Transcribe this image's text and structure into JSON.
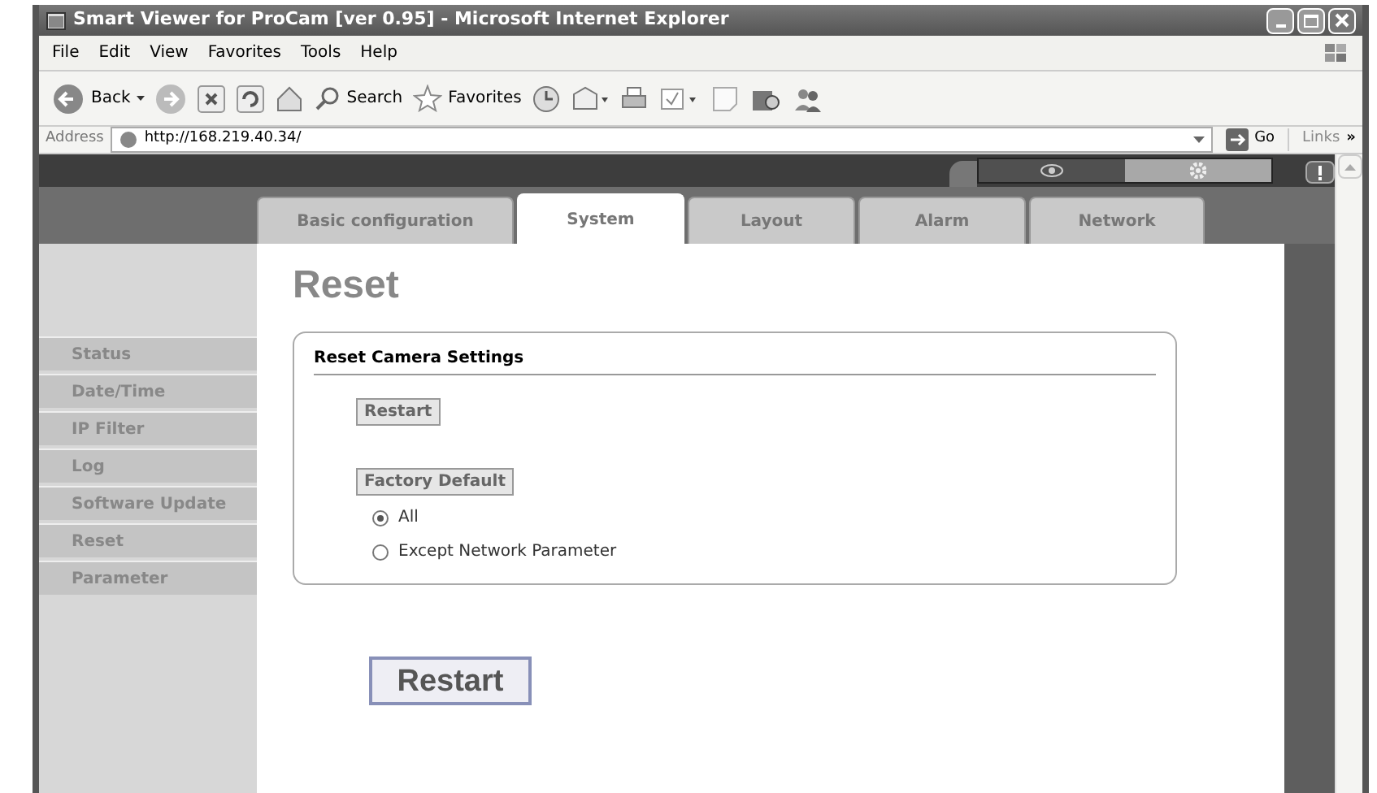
{
  "window": {
    "title": "Smart Viewer for ProCam [ver 0.95] - Microsoft Internet Explorer"
  },
  "menu": [
    "File",
    "Edit",
    "View",
    "Favorites",
    "Tools",
    "Help"
  ],
  "toolbar": {
    "back": "Back",
    "search": "Search",
    "favorites": "Favorites"
  },
  "address": {
    "label": "Address",
    "url": "http://168.219.40.34/",
    "go": "Go",
    "links": "Links",
    "more": "»"
  },
  "top_icons": [
    {
      "kind": "eye",
      "selected": false
    },
    {
      "kind": "gear",
      "selected": true
    }
  ],
  "tabs": [
    {
      "label": "Basic configuration",
      "selected": false
    },
    {
      "label": "System",
      "selected": true
    },
    {
      "label": "Layout",
      "selected": false
    },
    {
      "label": "Alarm",
      "selected": false
    },
    {
      "label": "Network",
      "selected": false
    }
  ],
  "sidebar": {
    "items": [
      "Status",
      "Date/Time",
      "IP Filter",
      "Log",
      "Software Update",
      "Reset",
      "Parameter"
    ]
  },
  "heading": "Reset",
  "section": {
    "title": "Reset Camera Settings",
    "restart": "Restart",
    "factory_default": "Factory Default",
    "options": [
      {
        "label": "All",
        "selected": true
      },
      {
        "label": "Except Network Parameter",
        "selected": false
      }
    ]
  },
  "apply_button": "Restart"
}
